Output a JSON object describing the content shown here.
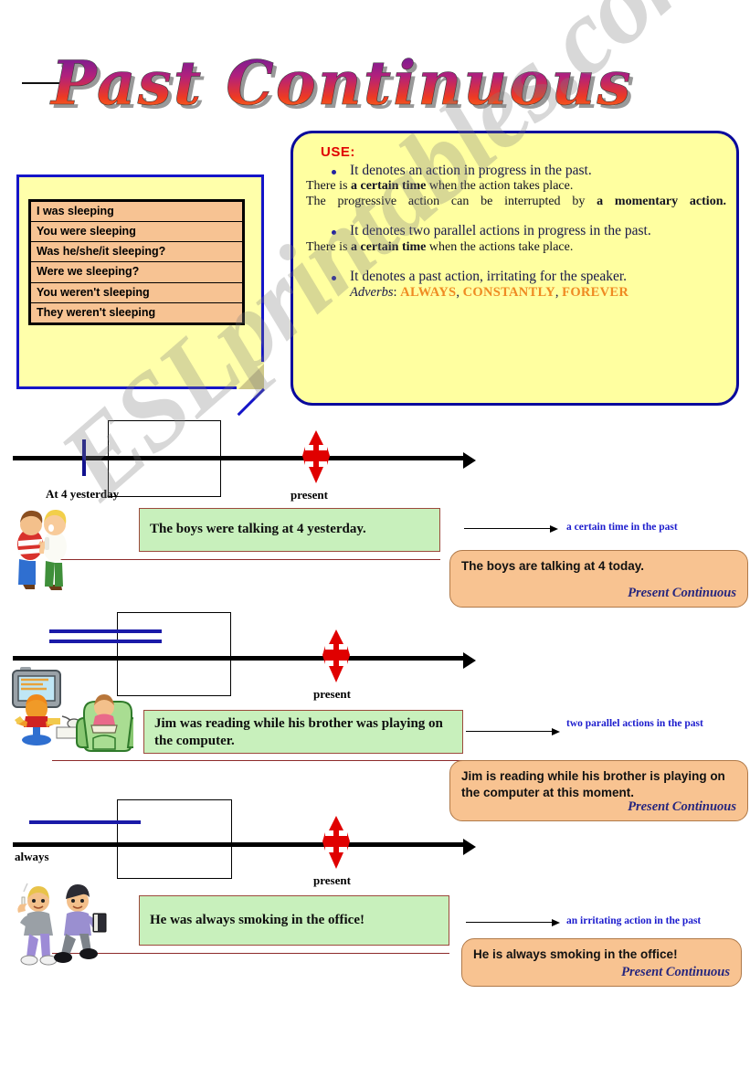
{
  "title": {
    "text": "Past Continuous",
    "colors": {
      "start": "#6a1fa8",
      "mid": "#d81f6a",
      "end": "#f4641e"
    }
  },
  "forms_note": {
    "rows": [
      "I was sleeping",
      "You were sleeping",
      "Was he/she/it sleeping?",
      "Were we sleeping?",
      "You weren't sleeping",
      "They weren't sleeping"
    ]
  },
  "use_box": {
    "heading": "USE:",
    "bullet1": "It denotes an action in progress in the past.",
    "note1a_pre": "There is ",
    "note1a_bold": "a certain time",
    "note1a_post": " when the action takes place.",
    "note1b_pre": "The progressive action can be interrupted by ",
    "note1b_bold": "a momentary action.",
    "bullet2": "It denotes two parallel actions in progress in the past.",
    "note2_pre": "There is ",
    "note2_bold": "a certain time",
    "note2_post": " when the actions take place.",
    "bullet3": "It denotes a past action, irritating for the speaker.",
    "adverbs_label": "Adverbs",
    "adverbs_colon": ": ",
    "adverb1": "ALWAYS",
    "adverb2": "CONSTANTLY",
    "adverb3": "FOREVER",
    "adverb_sep": ", "
  },
  "sections": [
    {
      "past_label": "At 4 yesterday",
      "present_label": "present",
      "past_sentence": "The boys were talking at 4 yesterday.",
      "annotation": "a certain time in the past",
      "present_sentence": "The boys are talking at 4 today.",
      "tense_label": "Present Continuous",
      "clipart": "two-boys-talking"
    },
    {
      "past_label": "",
      "present_label": "present",
      "past_sentence": "Jim was reading while his brother was playing on the computer.",
      "annotation": "two parallel actions in the past",
      "present_sentence": "Jim is reading while his brother is playing on the computer at this moment.",
      "tense_label": "Present Continuous",
      "clipart": "computer-and-reading"
    },
    {
      "past_label": "always",
      "present_label": "present",
      "past_sentence": "He was always smoking in the office!",
      "annotation": "an irritating action in the past",
      "present_sentence": "He is always smoking in the office!",
      "tense_label": "Present Continuous",
      "clipart": "two-men-smoking"
    }
  ],
  "watermark": {
    "text": "ESLprintables.com"
  },
  "colors": {
    "note_yellow": "#ffffaa",
    "note_border_blue": "#1515c8",
    "table_orange": "#f7c393",
    "use_yellow": "#ffffa0",
    "use_border": "#0a0a9c",
    "green_box": "#c8f0bc",
    "green_border": "#9c4a3c",
    "orange_box": "#f8c391",
    "annotation_blue": "#1b1bcd",
    "use_heading_red": "#e00000",
    "adverb_orange": "#ef8a22",
    "present_red": "#e00000",
    "timeline_black": "#000000",
    "blue_line": "#1a1aa8"
  }
}
